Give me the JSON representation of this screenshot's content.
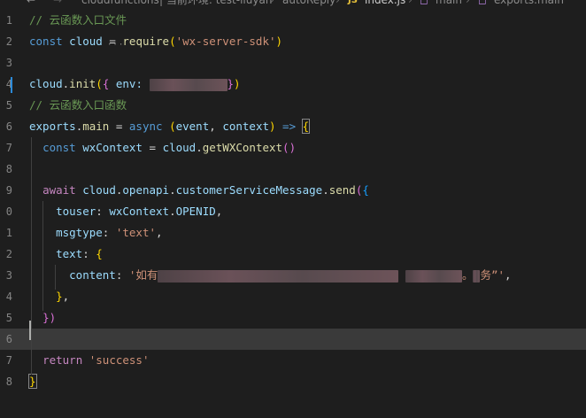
{
  "breadcrumb": {
    "folder": "cloudfunctions",
    "env": "| 当前环境: test-liuyan",
    "subfolder": "autoReply",
    "file_badge": "JS",
    "file": "index.js",
    "symbol1": "main",
    "symbol2": "exports.main"
  },
  "lines": [
    {
      "num": "1",
      "tokens": [
        {
          "t": "// 云函数入口文件",
          "c": "cm"
        }
      ]
    },
    {
      "num": "2",
      "tokens": [
        {
          "t": "const",
          "c": "kw"
        },
        {
          "t": " cloud ",
          "c": "vr"
        },
        {
          "t": "= ",
          "c": "pl"
        },
        {
          "t": "require",
          "c": "fn"
        },
        {
          "t": "(",
          "c": "br1"
        },
        {
          "t": "'wx-server-sdk'",
          "c": "st"
        },
        {
          "t": ")",
          "c": "br1"
        }
      ]
    },
    {
      "num": "3",
      "tokens": []
    },
    {
      "num": "4",
      "tokens": [
        {
          "t": "cloud",
          "c": "vr"
        },
        {
          "t": ".",
          "c": "pl"
        },
        {
          "t": "init",
          "c": "fn"
        },
        {
          "t": "(",
          "c": "br1"
        },
        {
          "t": "{",
          "c": "br2"
        },
        {
          "t": " env: ",
          "c": "prop"
        },
        {
          "r": 88
        },
        {
          "t": "}",
          "c": "br2"
        },
        {
          "t": ")",
          "c": "br1"
        }
      ]
    },
    {
      "num": "5",
      "tokens": [
        {
          "t": "// 云函数入口函数",
          "c": "cm"
        }
      ]
    },
    {
      "num": "6",
      "tokens": [
        {
          "t": "exports",
          "c": "vr"
        },
        {
          "t": ".",
          "c": "pl"
        },
        {
          "t": "main",
          "c": "fn"
        },
        {
          "t": " = ",
          "c": "pl"
        },
        {
          "t": "async",
          "c": "kw"
        },
        {
          "t": " ",
          "c": "pl"
        },
        {
          "t": "(",
          "c": "br1"
        },
        {
          "t": "event",
          "c": "vr"
        },
        {
          "t": ", ",
          "c": "pl"
        },
        {
          "t": "context",
          "c": "vr"
        },
        {
          "t": ")",
          "c": "br1"
        },
        {
          "t": " => ",
          "c": "kw"
        },
        {
          "t": "{",
          "c": "br1",
          "box": true
        }
      ]
    },
    {
      "num": "7",
      "tokens": [
        {
          "t": "  "
        },
        {
          "t": "const",
          "c": "kw"
        },
        {
          "t": " wxContext ",
          "c": "vr"
        },
        {
          "t": "= ",
          "c": "pl"
        },
        {
          "t": "cloud",
          "c": "vr"
        },
        {
          "t": ".",
          "c": "pl"
        },
        {
          "t": "getWXContext",
          "c": "fn"
        },
        {
          "t": "()",
          "c": "br2"
        }
      ]
    },
    {
      "num": "8",
      "tokens": []
    },
    {
      "num": "9",
      "tokens": [
        {
          "t": "  "
        },
        {
          "t": "await",
          "c": "kw2"
        },
        {
          "t": " cloud",
          "c": "vr"
        },
        {
          "t": ".",
          "c": "pl"
        },
        {
          "t": "openapi",
          "c": "vr"
        },
        {
          "t": ".",
          "c": "pl"
        },
        {
          "t": "customerServiceMessage",
          "c": "vr"
        },
        {
          "t": ".",
          "c": "pl"
        },
        {
          "t": "send",
          "c": "fn"
        },
        {
          "t": "(",
          "c": "br2"
        },
        {
          "t": "{",
          "c": "br3"
        }
      ]
    },
    {
      "num": "0",
      "tokens": [
        {
          "t": "    "
        },
        {
          "t": "touser",
          "c": "prop"
        },
        {
          "t": ": ",
          "c": "pl"
        },
        {
          "t": "wxContext",
          "c": "vr"
        },
        {
          "t": ".",
          "c": "pl"
        },
        {
          "t": "OPENID",
          "c": "vr"
        },
        {
          "t": ",",
          "c": "pl"
        }
      ]
    },
    {
      "num": "1",
      "tokens": [
        {
          "t": "    "
        },
        {
          "t": "msgtype",
          "c": "prop"
        },
        {
          "t": ": ",
          "c": "pl"
        },
        {
          "t": "'text'",
          "c": "st"
        },
        {
          "t": ",",
          "c": "pl"
        }
      ]
    },
    {
      "num": "2",
      "tokens": [
        {
          "t": "    "
        },
        {
          "t": "text",
          "c": "prop"
        },
        {
          "t": ": ",
          "c": "pl"
        },
        {
          "t": "{",
          "c": "br1"
        }
      ]
    },
    {
      "num": "3",
      "tokens": [
        {
          "t": "      "
        },
        {
          "t": "content",
          "c": "prop"
        },
        {
          "t": ": ",
          "c": "pl"
        },
        {
          "t": "'如有",
          "c": "st"
        },
        {
          "r": 272
        },
        {
          "t": " ",
          "c": "pl"
        },
        {
          "r": 64
        },
        {
          "t": "。",
          "c": "st"
        },
        {
          "r": 8
        },
        {
          "t": "务”'",
          "c": "st"
        },
        {
          "t": ",",
          "c": "pl"
        }
      ]
    },
    {
      "num": "4",
      "tokens": [
        {
          "t": "    "
        },
        {
          "t": "}",
          "c": "br1"
        },
        {
          "t": ",",
          "c": "pl"
        }
      ]
    },
    {
      "num": "5",
      "tokens": [
        {
          "t": "  "
        },
        {
          "t": "})",
          "c": "br2"
        }
      ]
    },
    {
      "num": "6",
      "tokens": []
    },
    {
      "num": "7",
      "tokens": [
        {
          "t": "  "
        },
        {
          "t": "return",
          "c": "kw2"
        },
        {
          "t": " ",
          "c": "pl"
        },
        {
          "t": "'success'",
          "c": "st"
        }
      ]
    },
    {
      "num": "8",
      "tokens": [
        {
          "t": "}",
          "c": "br1",
          "box": true
        }
      ]
    }
  ]
}
